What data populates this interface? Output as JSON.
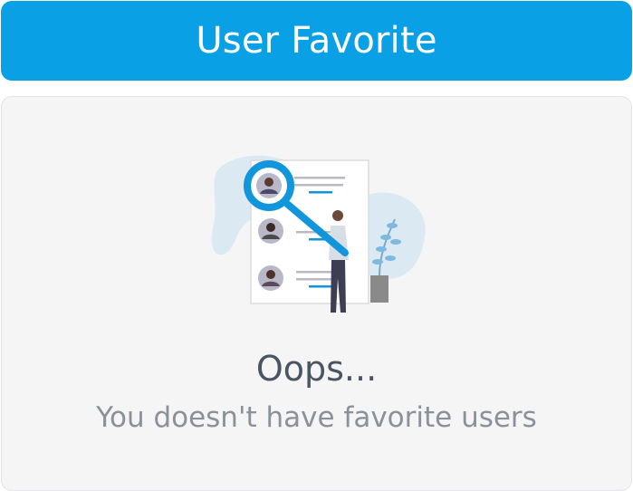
{
  "header": {
    "title": "User Favorite",
    "color": "#0aa0e6"
  },
  "empty_state": {
    "illustration_icon": "magnifier-user-search-illustration",
    "title": "Oops...",
    "message": "You doesn't have favorite users"
  }
}
